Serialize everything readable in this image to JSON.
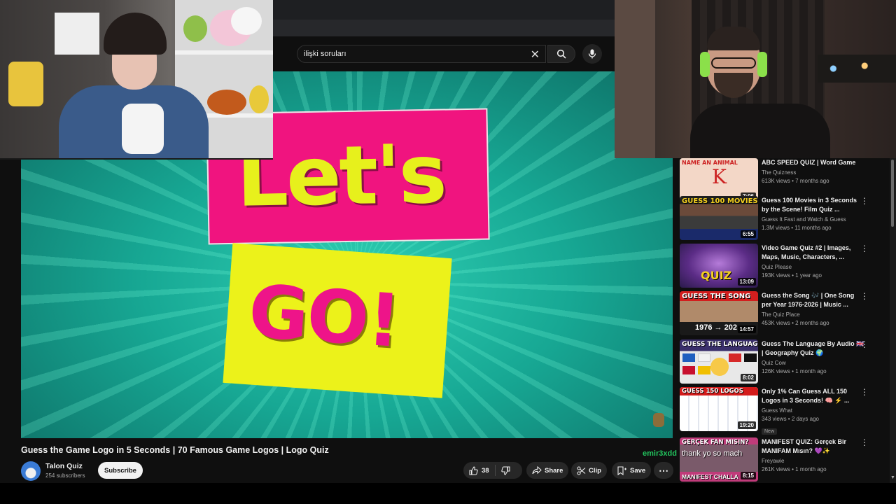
{
  "search": {
    "query": "ilişki soruları",
    "clear_icon": "close-icon",
    "search_icon": "search-icon",
    "mic_icon": "mic-icon"
  },
  "player": {
    "line1": "Let's",
    "line2": "GO!",
    "bg_color": "#17a894",
    "sign1_color": "#f0147f",
    "sign2_color": "#ecf21a"
  },
  "video": {
    "title": "Guess the Game Logo in 5 Seconds | 70 Famous Game Logos | Logo Quiz",
    "channel": "Talon Quiz",
    "subscribers": "254 subscribers",
    "subscribe_label": "Subscribe",
    "likes": "38",
    "share_label": "Share",
    "clip_label": "Clip",
    "save_label": "Save"
  },
  "chat": {
    "user": "emir3xdd",
    "message": "thank yo so mach"
  },
  "recommendations": [
    {
      "title": "ABC SPEED QUIZ | Word Game",
      "channel": "The Quizness",
      "stats": "613K views • 7 months ago",
      "duration": "7:06",
      "thumb_text": "NAME AN ANIMAL",
      "thumb_color": "#f3d7c7"
    },
    {
      "title": "Guess 100 Movies in 3 Seconds by the Scene! Film Quiz ...",
      "channel": "Guess It Fast and Watch & Guess",
      "stats": "1.3M views • 11 months ago",
      "duration": "6:55",
      "thumb_text": "GUESS 100 MOVIES",
      "thumb_color": "#2a2a2a"
    },
    {
      "title": "Video Game Quiz #2 | Images, Maps, Music, Characters, ...",
      "channel": "Quiz Please",
      "stats": "193K views • 1 year ago",
      "duration": "13:09",
      "thumb_text": "QUIZ",
      "thumb_color": "#5b2c86"
    },
    {
      "title": "Guess the Song 🎶 | One Song per Year 1976-2026 | Music ...",
      "channel": "The Quiz Place",
      "stats": "453K views • 2 months ago",
      "duration": "14:57",
      "thumb_text": "GUESS THE SONG",
      "thumb_color": "#8a1d1d"
    },
    {
      "title": "Guess The Language By Audio 🇬🇧 | Geography Quiz 🌍",
      "channel": "Quiz Cow",
      "stats": "126K views • 1 month ago",
      "duration": "8:02",
      "thumb_text": "GUESS THE LANGUAGE",
      "thumb_color": "#3a2f6b"
    },
    {
      "title": "Only 1% Can Guess ALL 150 Logos in 3 Seconds! 🧠 ⚡ ...",
      "channel": "Guess What",
      "stats": "343 views • 2 days ago",
      "duration": "19:20",
      "badge": "New",
      "thumb_text": "GUESS 150 LOGOS",
      "thumb_color": "#e9eef7"
    },
    {
      "title": "MANIFEST QUIZ: Gerçek Bir MANIFAM Mısın? 💜✨",
      "channel": "Freyawie",
      "stats": "261K views • 1 month ago",
      "duration": "8:15",
      "thumb_text": "GERÇEK FAN MISIN?",
      "thumb_color": "#c03b7a"
    }
  ]
}
